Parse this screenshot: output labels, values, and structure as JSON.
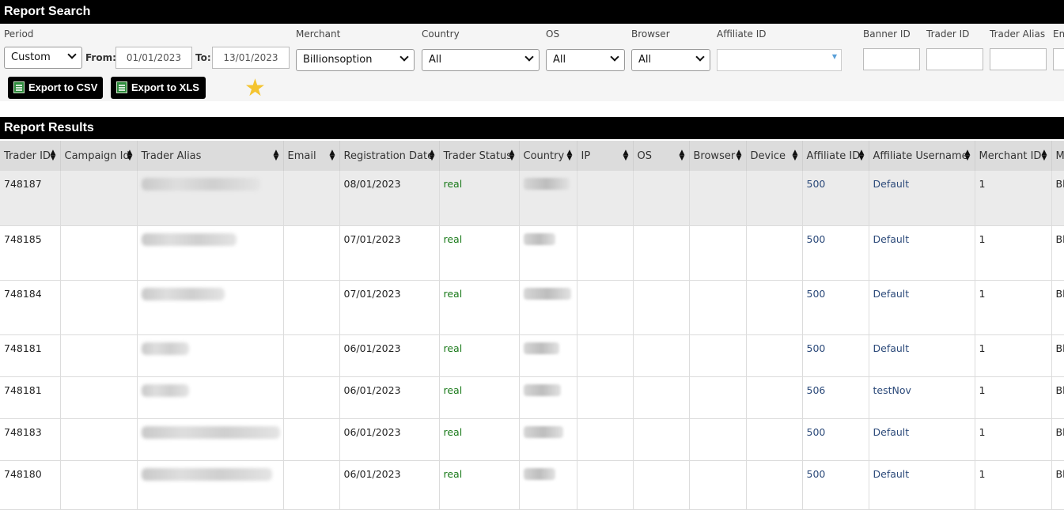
{
  "search": {
    "title": "Report Search",
    "period": {
      "label": "Period",
      "value": "Custom"
    },
    "from_label": "From:",
    "from_value": "01/01/2023",
    "to_label": "To:",
    "to_value": "13/01/2023",
    "merchant": {
      "label": "Merchant",
      "value": "Billionsoption"
    },
    "country": {
      "label": "Country",
      "value": "All"
    },
    "os": {
      "label": "OS",
      "value": "All"
    },
    "browser": {
      "label": "Browser",
      "value": "All"
    },
    "affiliate_id_label": "Affiliate ID",
    "banner_id_label": "Banner ID",
    "trader_id_label": "Trader ID",
    "trader_alias_label": "Trader Alias",
    "email_label_partial": "Em",
    "export_csv": "Export to CSV",
    "export_xls": "Export to XLS",
    "star_color": "#f4c430"
  },
  "results": {
    "title": "Report Results",
    "columns": [
      "Trader ID",
      "Campaign Id",
      "Trader Alias",
      "Email",
      "Registration Date",
      "Trader Status",
      "Country",
      "IP",
      "OS",
      "Browser",
      "Device",
      "Affiliate ID",
      "Affiliate Username",
      "Merchant ID",
      "M"
    ],
    "rows": [
      {
        "trader_id": "748187",
        "date": "08/01/2023",
        "status": "real",
        "affiliate_id": "500",
        "affiliate_username": "Default",
        "merchant_id": "1",
        "m": "Bl"
      },
      {
        "trader_id": "748185",
        "date": "07/01/2023",
        "status": "real",
        "affiliate_id": "500",
        "affiliate_username": "Default",
        "merchant_id": "1",
        "m": "Bl"
      },
      {
        "trader_id": "748184",
        "date": "07/01/2023",
        "status": "real",
        "affiliate_id": "500",
        "affiliate_username": "Default",
        "merchant_id": "1",
        "m": "Bl"
      },
      {
        "trader_id": "748181",
        "date": "06/01/2023",
        "status": "real",
        "affiliate_id": "500",
        "affiliate_username": "Default",
        "merchant_id": "1",
        "m": "Bl"
      },
      {
        "trader_id": "748181",
        "date": "06/01/2023",
        "status": "real",
        "affiliate_id": "506",
        "affiliate_username": "testNov",
        "merchant_id": "1",
        "m": "Bl"
      },
      {
        "trader_id": "748183",
        "date": "06/01/2023",
        "status": "real",
        "affiliate_id": "500",
        "affiliate_username": "Default",
        "merchant_id": "1",
        "m": "Bl"
      },
      {
        "trader_id": "748180",
        "date": "06/01/2023",
        "status": "real",
        "affiliate_id": "500",
        "affiliate_username": "Default",
        "merchant_id": "1",
        "m": "Bl"
      }
    ],
    "status_color": "#1a7a1a",
    "link_color": "#2c4a7a"
  }
}
